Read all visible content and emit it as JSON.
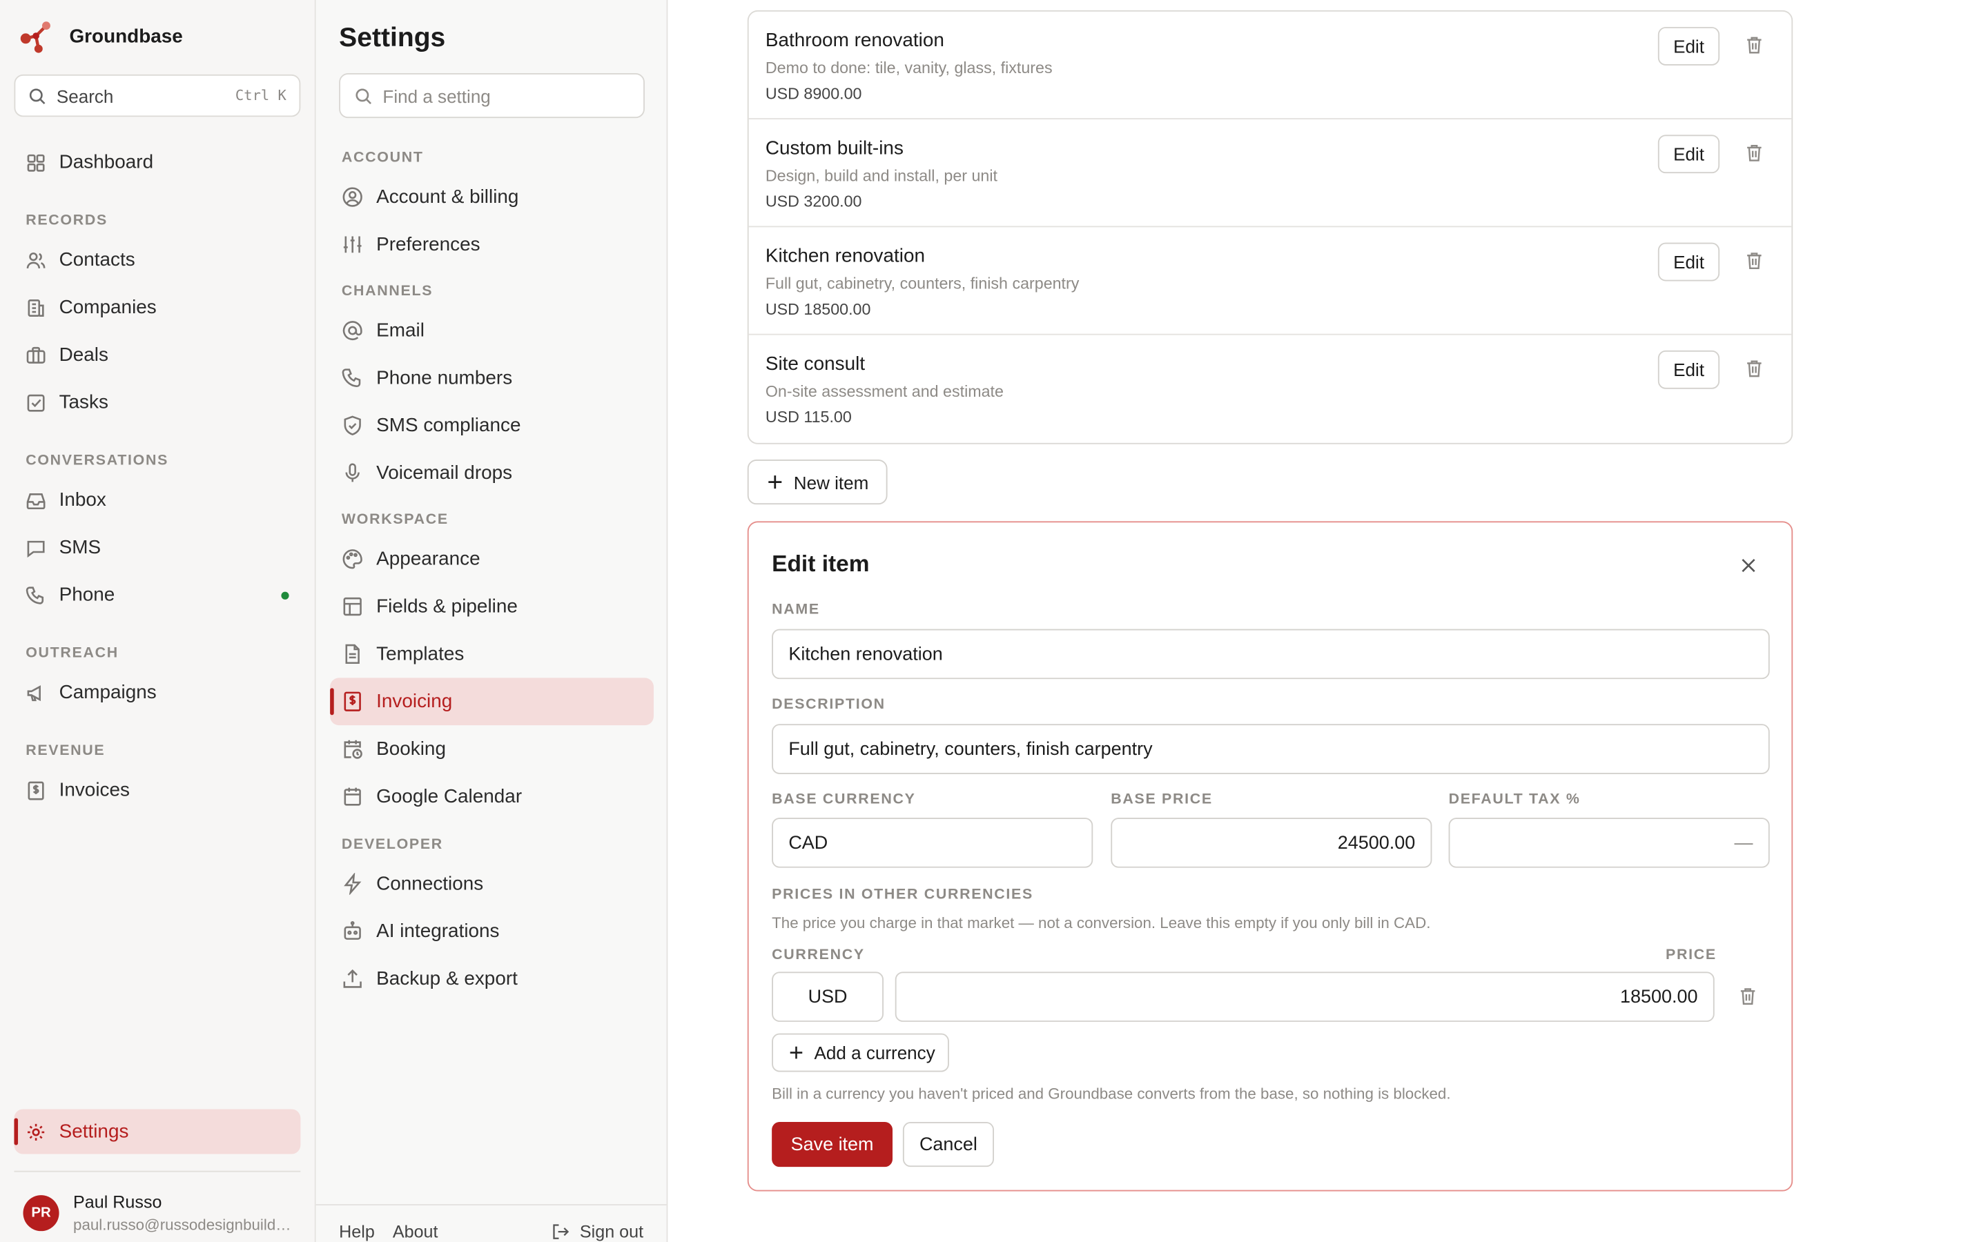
{
  "colors": {
    "accent": "#b51e1e",
    "accent_bg": "#f4dcdb",
    "online": "#1f8a3b",
    "panel_border": "#e58e8b"
  },
  "app": {
    "name": "Groundbase",
    "logo_icon": "graph-nodes-logo"
  },
  "nav": {
    "search": {
      "placeholder": "Search",
      "shortcut": "Ctrl K"
    },
    "dashboard": "Dashboard",
    "groups": {
      "records": "RECORDS",
      "conversations": "CONVERSATIONS",
      "outreach": "OUTREACH",
      "revenue": "REVENUE"
    },
    "records": [
      "Contacts",
      "Companies",
      "Deals",
      "Tasks"
    ],
    "conversations": [
      "Inbox",
      "SMS",
      "Phone"
    ],
    "outreach": [
      "Campaigns"
    ],
    "revenue": [
      "Invoices"
    ],
    "settings": "Settings"
  },
  "user": {
    "initials": "PR",
    "name": "Paul Russo",
    "email": "paul.russo@russodesignbuild.com"
  },
  "settings": {
    "title": "Settings",
    "search_placeholder": "Find a setting",
    "groups": {
      "account": "ACCOUNT",
      "channels": "CHANNELS",
      "workspace": "WORKSPACE",
      "developer": "DEVELOPER"
    },
    "account": [
      "Account & billing",
      "Preferences"
    ],
    "channels": [
      "Email",
      "Phone numbers",
      "SMS compliance",
      "Voicemail drops"
    ],
    "workspace": [
      "Appearance",
      "Fields & pipeline",
      "Templates",
      "Invoicing",
      "Booking",
      "Google Calendar"
    ],
    "developer": [
      "Connections",
      "AI integrations",
      "Backup & export"
    ],
    "active": "Invoicing",
    "footer": {
      "help": "Help",
      "about": "About",
      "sign_out": "Sign out"
    }
  },
  "items": [
    {
      "name": "Bathroom renovation",
      "description": "Demo to done: tile, vanity, glass, fixtures",
      "price": "USD 8900.00",
      "edit_label": "Edit"
    },
    {
      "name": "Custom built-ins",
      "description": "Design, build and install, per unit",
      "price": "USD 3200.00",
      "edit_label": "Edit"
    },
    {
      "name": "Kitchen renovation",
      "description": "Full gut, cabinetry, counters, finish carpentry",
      "price": "USD 18500.00",
      "edit_label": "Edit"
    },
    {
      "name": "Site consult",
      "description": "On-site assessment and estimate",
      "price": "USD 115.00",
      "edit_label": "Edit"
    }
  ],
  "new_item_label": "New item",
  "edit_item": {
    "title": "Edit item",
    "name_label": "NAME",
    "name_value": "Kitchen renovation",
    "description_label": "DESCRIPTION",
    "description_value": "Full gut, cabinetry, counters, finish carpentry",
    "base_currency_label": "BASE CURRENCY",
    "base_currency_value": "CAD",
    "base_price_label": "BASE PRICE",
    "base_price_value": "24500.00",
    "tax_label": "DEFAULT TAX %",
    "tax_placeholder": "—",
    "other_prices_label": "PRICES IN OTHER CURRENCIES",
    "other_prices_hint": "The price you charge in that market — not a conversion. Leave this empty if you only bill in CAD.",
    "currency_col": "CURRENCY",
    "price_col": "PRICE",
    "rows": [
      {
        "currency": "USD",
        "price": "18500.00"
      }
    ],
    "add_currency_label": "Add a currency",
    "footer_hint": "Bill in a currency you haven't priced and Groundbase converts from the base, so nothing is blocked.",
    "save_label": "Save item",
    "cancel_label": "Cancel"
  }
}
